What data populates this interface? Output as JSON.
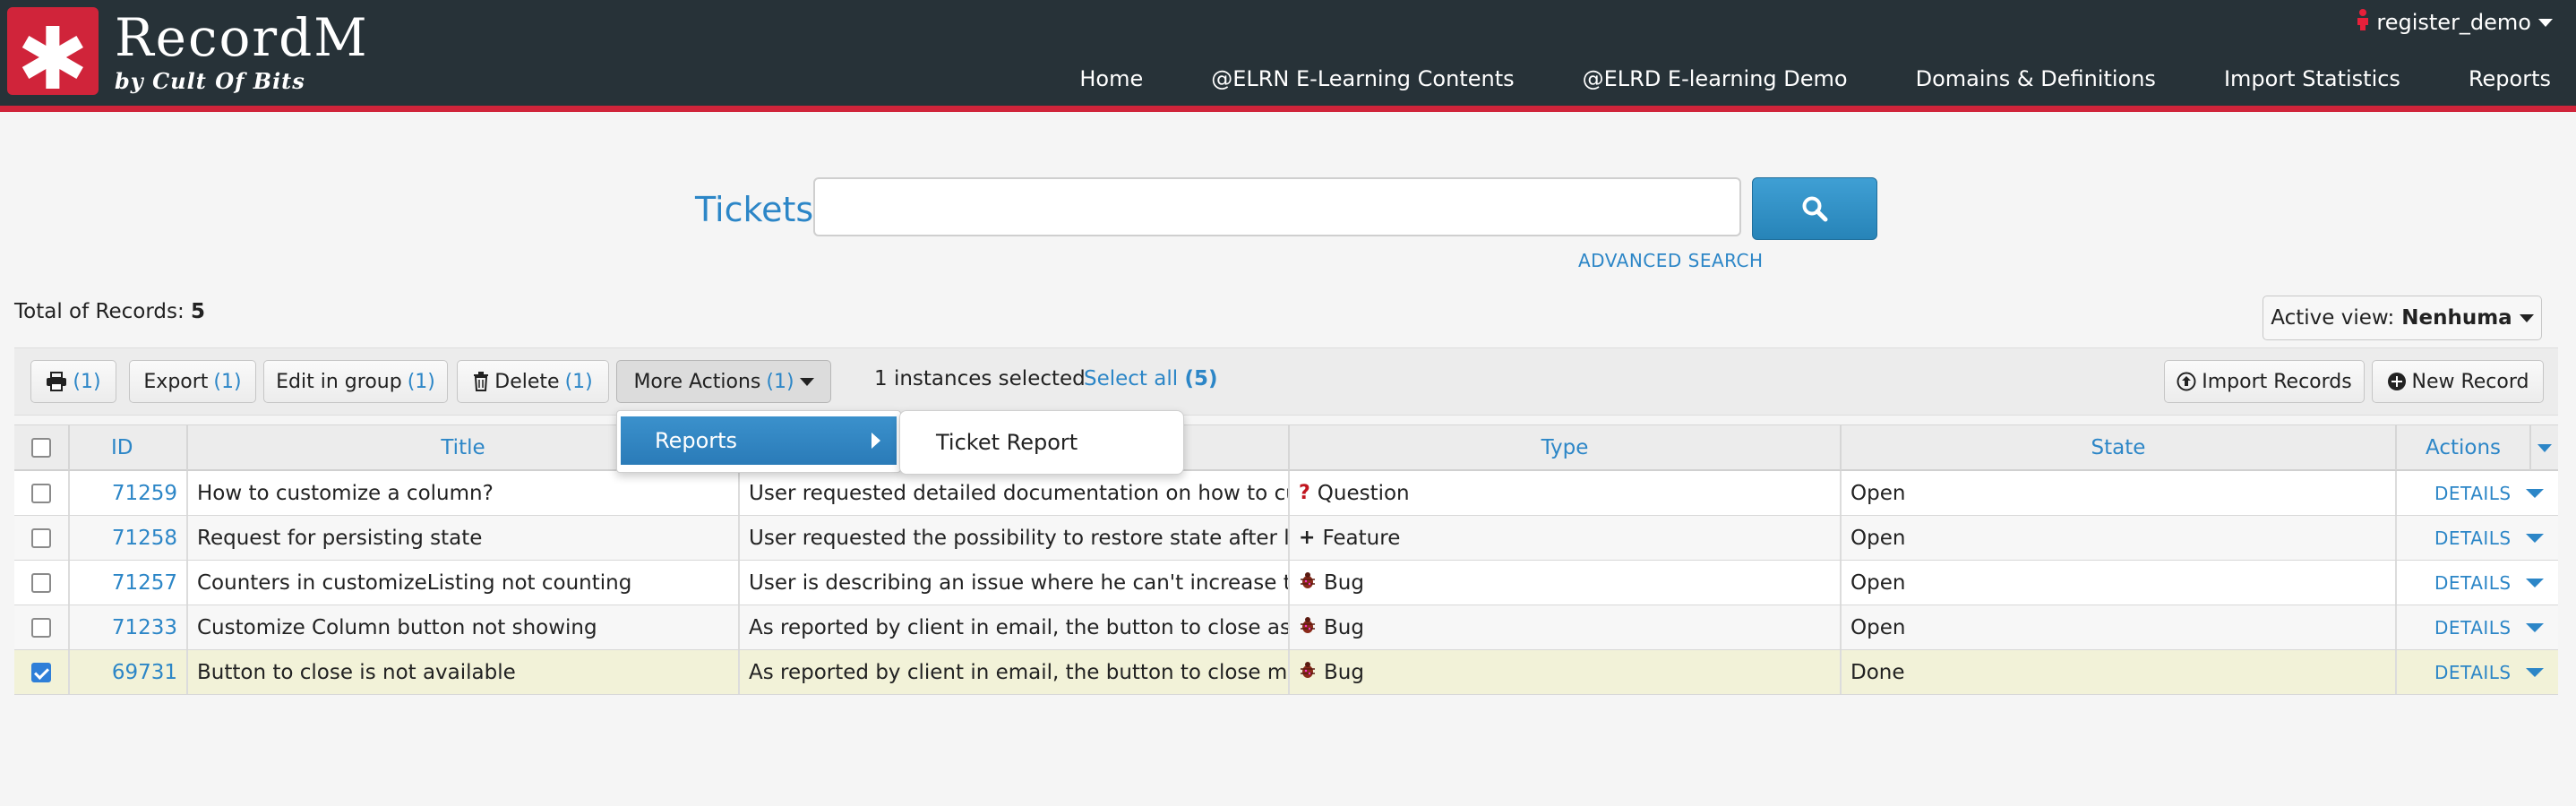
{
  "header": {
    "brand_name": "RecordM",
    "brand_sub": "by Cult Of Bits",
    "logo_glyph": "✱",
    "user": "register_demo",
    "nav": [
      "Home",
      "@ELRN E-Learning Contents",
      "@ELRD E-learning Demo",
      "Domains & Definitions",
      "Import Statistics",
      "Reports"
    ]
  },
  "search": {
    "label": "Tickets",
    "value": "",
    "advanced": "ADVANCED SEARCH"
  },
  "records": {
    "total_label": "Total of Records:",
    "total": "5",
    "active_view_label": "Active view:",
    "active_view": "Nenhuma"
  },
  "toolbar": {
    "print_count": "(1)",
    "export_label": "Export",
    "export_count": "(1)",
    "edit_label": "Edit in group",
    "edit_count": "(1)",
    "delete_label": "Delete",
    "delete_count": "(1)",
    "more_label": "More Actions",
    "more_count": "(1)",
    "selected_text": "1 instances selected",
    "select_all": "Select all",
    "select_all_count": "(5)",
    "import_label": "Import Records",
    "new_label": "New Record"
  },
  "menu": {
    "item": "Reports",
    "sub_item": "Ticket Report"
  },
  "table": {
    "headers": {
      "id": "ID",
      "title": "Title",
      "type": "Type",
      "state": "State",
      "actions": "Actions"
    },
    "rows": [
      {
        "id": "71259",
        "title": "How to customize a column?",
        "desc": "User requested detailed documentation on how to custo",
        "type": "Question",
        "type_icon": "question-icon",
        "state": "Open",
        "action": "DETAILS",
        "checked": false
      },
      {
        "id": "71258",
        "title": "Request for persisting state",
        "desc": "User requested the possibility to restore state after lea",
        "type": "Feature",
        "type_icon": "plus-icon",
        "state": "Open",
        "action": "DETAILS",
        "checked": false
      },
      {
        "id": "71257",
        "title": "Counters in customizeListing not counting",
        "desc": "User is describing an issue where he can't increase the c",
        "type": "Bug",
        "type_icon": "bug-icon",
        "state": "Open",
        "action": "DETAILS",
        "checked": false
      },
      {
        "id": "71233",
        "title": "Customize Column button not showing",
        "desc": "As reported by client in email, the button to close assig",
        "type": "Bug",
        "type_icon": "bug-icon",
        "state": "Open",
        "action": "DETAILS",
        "checked": false
      },
      {
        "id": "69731",
        "title": "Button to close is not available",
        "desc": "As reported by client in email, the button to close mod",
        "type": "Bug",
        "type_icon": "bug-icon",
        "state": "Done",
        "action": "DETAILS",
        "checked": true
      }
    ]
  },
  "colors": {
    "header_bg": "#273238",
    "brand_red": "#d0243a",
    "link_blue": "#2c86c7",
    "selected_row": "#f2f2d8"
  }
}
